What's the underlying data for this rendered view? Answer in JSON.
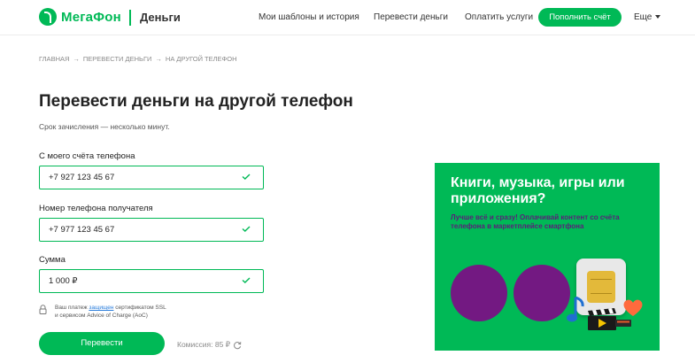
{
  "header": {
    "brand": "МегаФон",
    "section": "Деньги",
    "nav": [
      "Мои шаблоны и история",
      "Перевести деньги",
      "Оплатить услуги"
    ],
    "cta": "Пополнить счёт",
    "more": "Еще"
  },
  "breadcrumb": [
    "ГЛАВНАЯ",
    "ПЕРЕВЕСТИ ДЕНЬГИ",
    "НА ДРУГОЙ ТЕЛЕФОН"
  ],
  "breadcrumb_sep": "→",
  "page": {
    "title": "Перевести деньги на другой телефон",
    "subtitle": "Срок зачисления — несколько минут."
  },
  "form": {
    "from_label": "С моего счёта телефона",
    "from_value": "+7 927 123 45 67",
    "to_label": "Номер телефона получателя",
    "to_value": "+7 977 123 45 67",
    "amount_label": "Сумма",
    "amount_value": "1 000 ₽",
    "secure_before": "Ваш платеж",
    "secure_link": "защищен",
    "secure_after": "сертификатом SSL",
    "secure_line2": "и сервисом Advice of Charge (AoC)",
    "submit": "Перевести",
    "commission": "Комиссия: 85 ₽"
  },
  "banner": {
    "title": "Книги, музыка, игры или приложения?",
    "subtitle": "Лучше всё и сразу! Оплачивай контент со счёта телефона в маркетплейсе смартфона"
  },
  "colors": {
    "brand_green": "#00b956",
    "brand_purple": "#731982",
    "link_blue": "#2a7ddb"
  },
  "icons": [
    "megafon-logo-icon",
    "chevron-down-icon",
    "check-icon",
    "lock-icon",
    "refresh-icon",
    "sim-card-icon",
    "music-note-icon",
    "clapperboard-icon",
    "heart-icon",
    "book-icon"
  ]
}
